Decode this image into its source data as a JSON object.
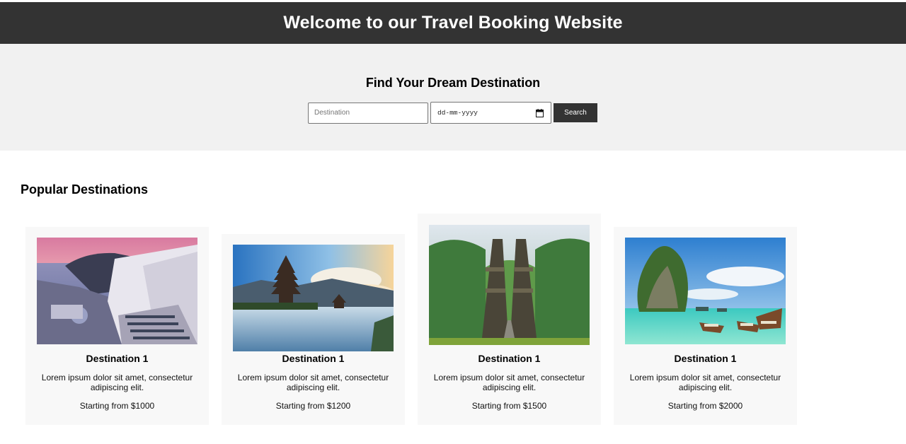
{
  "header": {
    "title": "Welcome to our Travel Booking Website"
  },
  "search": {
    "heading": "Find Your Dream Destination",
    "destination_placeholder": "Destination",
    "destination_value": "",
    "date_placeholder": "dd-mm-yyyy",
    "button_label": "Search"
  },
  "popular": {
    "title": "Popular Destinations",
    "cards": [
      {
        "name": "Destination 1",
        "description": "Lorem ipsum dolor sit amet, consectetur adipiscing elit.",
        "price": "Starting from $1000",
        "image": "greek-island-cliff-village-photo"
      },
      {
        "name": "Destination 1",
        "description": "Lorem ipsum dolor sit amet, consectetur adipiscing elit.",
        "price": "Starting from $1200",
        "image": "lake-temple-pagoda-photo"
      },
      {
        "name": "Destination 1",
        "description": "Lorem ipsum dolor sit amet, consectetur adipiscing elit.",
        "price": "Starting from $1500",
        "image": "jungle-temple-gate-photo"
      },
      {
        "name": "Destination 1",
        "description": "Lorem ipsum dolor sit amet, consectetur adipiscing elit.",
        "price": "Starting from $2000",
        "image": "rock-island-longtail-boats-photo"
      }
    ]
  },
  "colors": {
    "header_bg": "#333333",
    "hero_bg": "#f1f1f1",
    "card_bg": "#f8f8f8",
    "button_bg": "#333333"
  }
}
